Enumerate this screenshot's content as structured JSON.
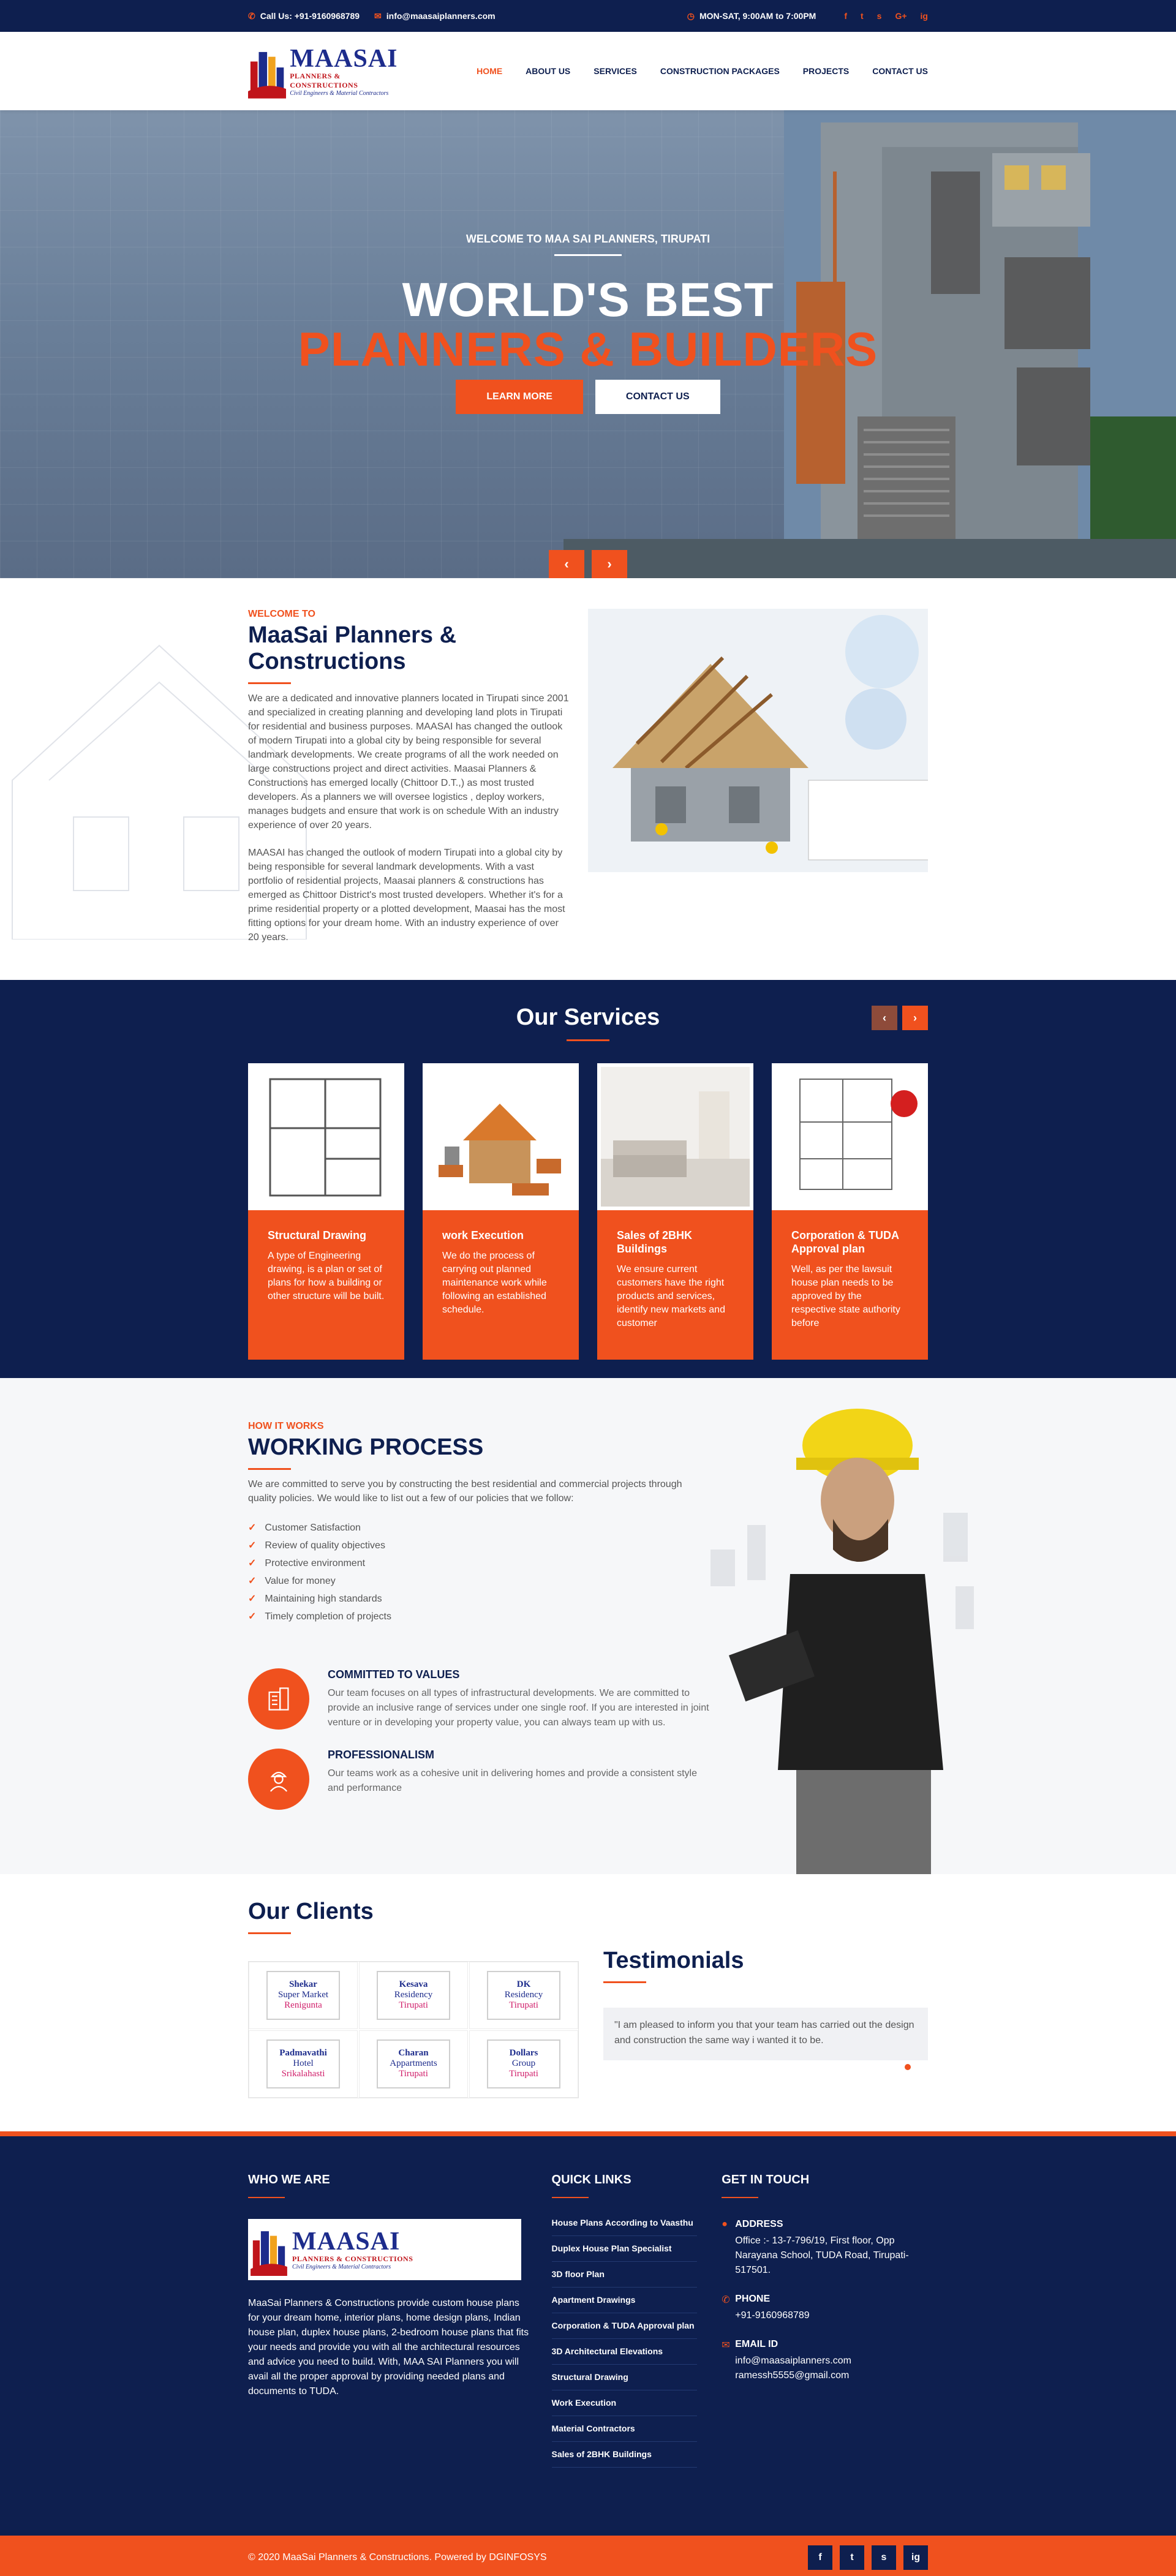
{
  "topbar": {
    "phone": "Call Us: +91-9160968789",
    "email": "info@maasaiplanners.com",
    "hours": "MON-SAT, 9:00AM to 7:00PM",
    "social": [
      "f",
      "t",
      "s",
      "G+",
      "ig"
    ]
  },
  "logo": {
    "name": "MAASAI",
    "sub": "PLANNERS & CONSTRUCTIONS",
    "sub2": "Civil Engineers & Material Contractors"
  },
  "nav": [
    "HOME",
    "ABOUT US",
    "SERVICES",
    "CONSTRUCTION PACKAGES",
    "PROJECTS",
    "CONTACT US"
  ],
  "hero": {
    "kicker": "WELCOME TO MAA SAI PLANNERS, TIRUPATI",
    "title1": "WORLD'S BEST",
    "title2": "PLANNERS & BUILDERS",
    "btn1": "LEARN MORE",
    "btn2": "CONTACT US",
    "prev": "‹",
    "next": "›"
  },
  "about": {
    "kicker": "WELCOME TO",
    "title": "MaaSai Planners & Constructions",
    "p1": "We are a dedicated and innovative planners located in Tirupati since 2001 and specialized in creating planning and developing land plots in Tirupati for residential and business purposes. MAASAI has changed the outlook of modern Tirupati into a global city by being responsible for several landmark developments. We create programs of all the work needed on large constructions project and direct activities. Maasai Planners & Constructions has emerged locally (Chittoor D.T.,) as  most trusted developers. As a planners we will oversee logistics , deploy workers, manages budgets and ensure that work is on schedule With an industry experience of over 20 years.",
    "p2": "MAASAI has changed the outlook of modern Tirupati into a global city by being responsible for several landmark developments. With a vast portfolio of residential projects, Maasai planners & constructions has emerged as Chittoor District's most trusted developers. Whether it's for a prime residential property or a plotted development, Maasai has the most fitting options for your dream home. With an industry experience of over 20 years."
  },
  "services": {
    "title": "Our Services",
    "cards": [
      {
        "title": "Structural Drawing",
        "text": "A type of Engineering drawing, is a plan or set of plans for how a building or other structure will be built."
      },
      {
        "title": "work Execution",
        "text": "We do the process of carrying out planned maintenance work while following an established schedule."
      },
      {
        "title": "Sales of 2BHK Buildings",
        "text": "We ensure current customers have the right products and services, identify new markets and customer"
      },
      {
        "title": "Corporation & TUDA Approval plan",
        "text": "Well, as per the lawsuit house plan needs to be approved by the respective state authority before"
      }
    ]
  },
  "process": {
    "kicker": "HOW IT WORKS",
    "title": "WORKING PROCESS",
    "intro": "We are committed to serve you by constructing the best residential and commercial  projects through quality policies. We would like to list out a few of our policies that we follow:",
    "checks": [
      "Customer Satisfaction",
      "Review of quality objectives",
      "Protective environment",
      "Value for money",
      "Maintaining high standards",
      "Timely completion of projects"
    ],
    "features": [
      {
        "title": "COMMITTED TO VALUES",
        "text": "Our team focuses on all types of infrastructural developments. We are committed to provide an inclusive range of services under one single roof. If you are interested in joint venture or in developing your property value, you can always team up with us."
      },
      {
        "title": "PROFESSIONALISM",
        "text": "Our teams work as a cohesive unit in delivering homes and provide a consistent style and performance"
      }
    ]
  },
  "clients": {
    "title": "Our Clients",
    "items": [
      {
        "a": "Shekar",
        "b": "Super Market",
        "c": "Renigunta"
      },
      {
        "a": "Kesava",
        "b": "Residency",
        "c": "Tirupati"
      },
      {
        "a": "DK",
        "b": "Residency",
        "c": "Tirupati"
      },
      {
        "a": "Padmavathi",
        "b": "Hotel",
        "c": "Srikalahasti"
      },
      {
        "a": "Charan",
        "b": "Appartments",
        "c": "Tirupati"
      },
      {
        "a": "Dollars",
        "b": "Group",
        "c": "Tirupati"
      }
    ]
  },
  "testimonials": {
    "title": "Testimonials",
    "quote": "\"I am pleased to inform you that your team has carried out the design and construction the same way i wanted it to be."
  },
  "footer": {
    "who_title": "WHO WE ARE",
    "who_text": "MaaSai Planners & Constructions provide custom house plans for your dream home, interior plans, home design plans, Indian house plan, duplex house plans, 2-bedroom house plans that fits your needs and provide you with all the architectural resources and advice you need to build. With, MAA SAI Planners you will avail all the proper approval by providing needed plans and documents to TUDA.",
    "links_title": "QUICK LINKS",
    "links": [
      "House Plans According to Vaasthu",
      "Duplex House Plan Specialist",
      "3D floor Plan",
      "Apartment Drawings",
      "Corporation & TUDA Approval plan",
      "3D Architectural Elevations",
      "Structural Drawing",
      "Work Execution",
      "Material Contractors",
      "Sales of 2BHK Buildings"
    ],
    "touch_title": "GET IN TOUCH",
    "address_h": "ADDRESS",
    "address": "Office :- 13-7-796/19, First floor, Opp Narayana School, TUDA Road, Tirupati-517501.",
    "phone_h": "PHONE",
    "phone": "+91-9160968789",
    "email_h": "EMAIL ID",
    "email1": "info@maasaiplanners.com",
    "email2": "ramessh5555@gmail.com",
    "copyright": "© 2020 MaaSai Planners & Constructions. Powered by DGINFOSYS",
    "social": [
      "f",
      "t",
      "s",
      "ig"
    ]
  },
  "colors": {
    "navy": "#0e1f4f",
    "accent": "#f0511e"
  }
}
